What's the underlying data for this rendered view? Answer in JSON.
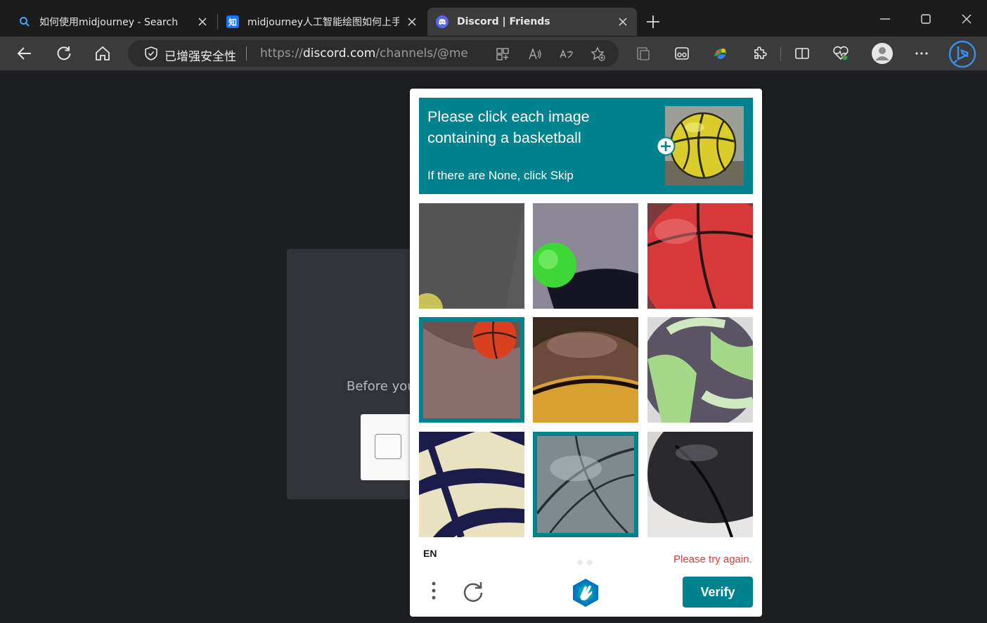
{
  "browser": {
    "tabs": [
      {
        "title": "如何使用midjourney - Search",
        "icon": "search-icon"
      },
      {
        "title": "midjourney人工智能绘图如何上手",
        "icon": "zhihu-icon",
        "icon_text": "知"
      },
      {
        "title": "Discord | Friends",
        "icon": "discord-icon",
        "active": true
      }
    ],
    "address": {
      "security_label": "已增强安全性",
      "url_prefix": "https://",
      "url_host": "discord.com",
      "url_path": "/channels/@me"
    }
  },
  "page": {
    "before_text": "Before you"
  },
  "captcha": {
    "prompt": "Please click each image containing a basketball",
    "hint": "If there are None, click Skip",
    "language": "EN",
    "error": "Please try again.",
    "verify_label": "Verify",
    "images": [
      {
        "subject": "gray-asphalt",
        "selected": false
      },
      {
        "subject": "tennis-ball",
        "selected": false
      },
      {
        "subject": "red-ball",
        "selected": false
      },
      {
        "subject": "basketball-on-ground",
        "selected": true
      },
      {
        "subject": "brown-ball",
        "selected": false
      },
      {
        "subject": "green-volleyball",
        "selected": false
      },
      {
        "subject": "striped-ball",
        "selected": false
      },
      {
        "subject": "gray-ball",
        "selected": true
      },
      {
        "subject": "black-white-ball",
        "selected": false
      }
    ]
  },
  "colors": {
    "accent": "#00838f",
    "error": "#e53935"
  }
}
